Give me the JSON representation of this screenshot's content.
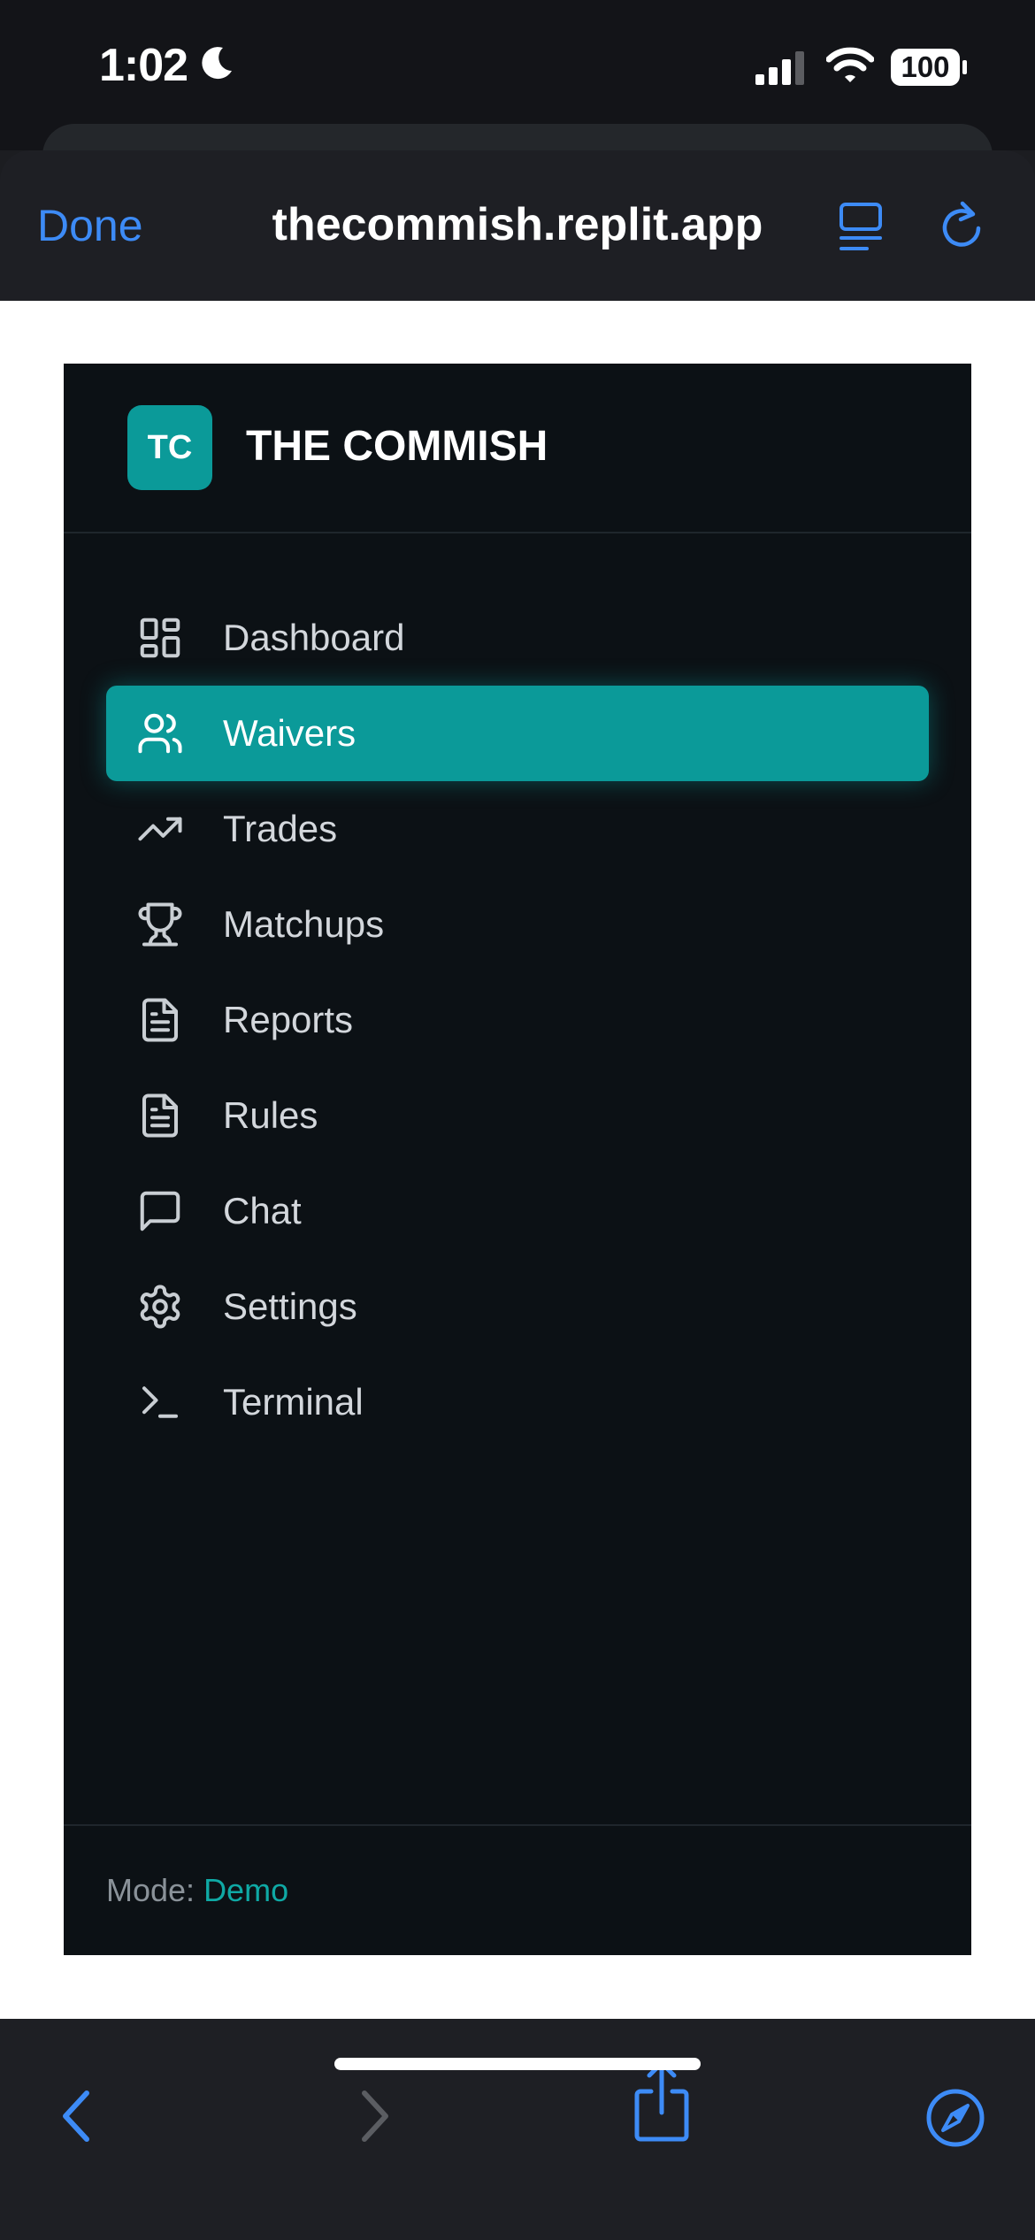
{
  "status_bar": {
    "time": "1:02",
    "battery": "100"
  },
  "browser": {
    "done_label": "Done",
    "url": "thecommish.replit.app"
  },
  "sidebar": {
    "logo_initials": "TC",
    "app_name": "THE COMMISH",
    "active_item": "Waivers",
    "items": [
      {
        "label": "Dashboard",
        "icon": "dashboard-icon"
      },
      {
        "label": "Waivers",
        "icon": "users-icon"
      },
      {
        "label": "Trades",
        "icon": "trending-up-icon"
      },
      {
        "label": "Matchups",
        "icon": "trophy-icon"
      },
      {
        "label": "Reports",
        "icon": "file-text-icon"
      },
      {
        "label": "Rules",
        "icon": "file-text-icon"
      },
      {
        "label": "Chat",
        "icon": "message-square-icon"
      },
      {
        "label": "Settings",
        "icon": "gear-icon"
      },
      {
        "label": "Terminal",
        "icon": "terminal-icon"
      }
    ],
    "footer": {
      "mode_label": "Mode: ",
      "mode_value": "Demo"
    }
  },
  "colors": {
    "accent": "#0b9a99",
    "ios_blue": "#3d8bf6",
    "sidebar_bg": "#0c1115"
  }
}
